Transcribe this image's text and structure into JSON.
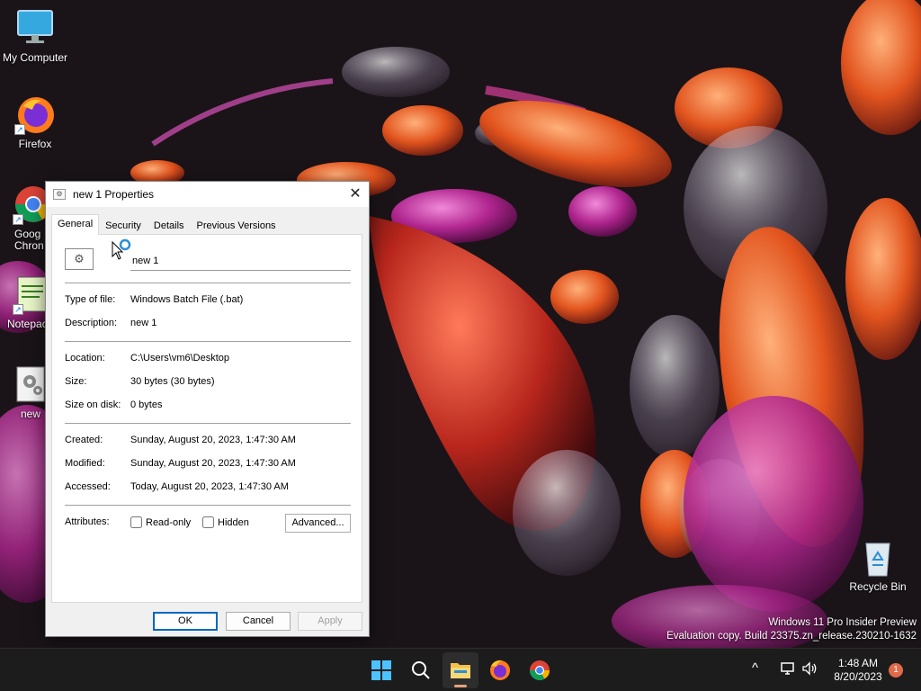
{
  "desktop": {
    "icons": [
      {
        "label": "My Computer",
        "icon": "computer-icon"
      },
      {
        "label": "Firefox",
        "icon": "firefox-icon"
      },
      {
        "label": "Goog\nChron",
        "icon": "chrome-icon"
      },
      {
        "label": "Notepac",
        "icon": "notepad-icon"
      },
      {
        "label": "new",
        "icon": "batch-file-icon"
      }
    ],
    "recycle_bin": {
      "label": "Recycle Bin",
      "icon": "recycle-bin-icon"
    }
  },
  "dialog": {
    "title": "new 1 Properties",
    "close_glyph": "✕",
    "tabs": [
      {
        "label": "General",
        "active": true
      },
      {
        "label": "Security",
        "active": false
      },
      {
        "label": "Details",
        "active": false
      },
      {
        "label": "Previous Versions",
        "active": false
      }
    ],
    "file_name": "new 1",
    "props": {
      "type": {
        "label": "Type of file:",
        "value": "Windows Batch File (.bat)"
      },
      "description": {
        "label": "Description:",
        "value": "new 1"
      },
      "location": {
        "label": "Location:",
        "value": "C:\\Users\\vm6\\Desktop"
      },
      "size": {
        "label": "Size:",
        "value": "30 bytes (30 bytes)"
      },
      "size_on_disk": {
        "label": "Size on disk:",
        "value": "0 bytes"
      },
      "created": {
        "label": "Created:",
        "value": "Sunday, August 20, 2023, 1:47:30 AM"
      },
      "modified": {
        "label": "Modified:",
        "value": "Sunday, August 20, 2023, 1:47:30 AM"
      },
      "accessed": {
        "label": "Accessed:",
        "value": "Today, August 20, 2023, 1:47:30 AM"
      }
    },
    "attributes": {
      "label": "Attributes:",
      "readonly_label": "Read-only",
      "readonly_checked": false,
      "hidden_label": "Hidden",
      "hidden_checked": false,
      "advanced_label": "Advanced..."
    },
    "buttons": {
      "ok": "OK",
      "cancel": "Cancel",
      "apply": "Apply"
    }
  },
  "watermark": {
    "line1": "Windows 11 Pro Insider Preview",
    "line2": "Evaluation copy. Build 23375.zn_release.230210-1632"
  },
  "taskbar": {
    "apps": [
      {
        "name": "start-button",
        "icon": "windows-logo-icon"
      },
      {
        "name": "search-button",
        "icon": "search-icon"
      },
      {
        "name": "file-explorer-button",
        "icon": "folder-icon",
        "active": true
      },
      {
        "name": "firefox-taskbar-button",
        "icon": "firefox-icon"
      },
      {
        "name": "chrome-taskbar-button",
        "icon": "chrome-icon"
      }
    ],
    "tray_chevron": "^",
    "time": "1:48 AM",
    "date": "8/20/2023",
    "notification_count": "1"
  },
  "colors": {
    "accent": "#0067c0",
    "notification": "#e06a4a",
    "taskbar": "#1c1c1c"
  }
}
